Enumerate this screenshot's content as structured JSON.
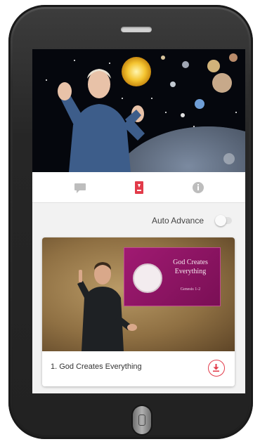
{
  "device": {
    "speaker_icon": "speaker-slot",
    "home_button_icon": "home-button"
  },
  "tabs": [
    {
      "icon": "chat-bubble-icon",
      "active": false
    },
    {
      "icon": "bookmark-icon",
      "active": true
    },
    {
      "icon": "info-icon",
      "active": false
    }
  ],
  "auto_advance": {
    "label": "Auto Advance",
    "enabled": false
  },
  "lesson": {
    "slide_title": "God Creates Everything",
    "slide_reference": "Genesis 1-2",
    "title": "1. God Creates Everything",
    "action_icon": "download-icon"
  },
  "colors": {
    "accent": "#e23b4a",
    "slide_magenta": "#a01a72"
  }
}
